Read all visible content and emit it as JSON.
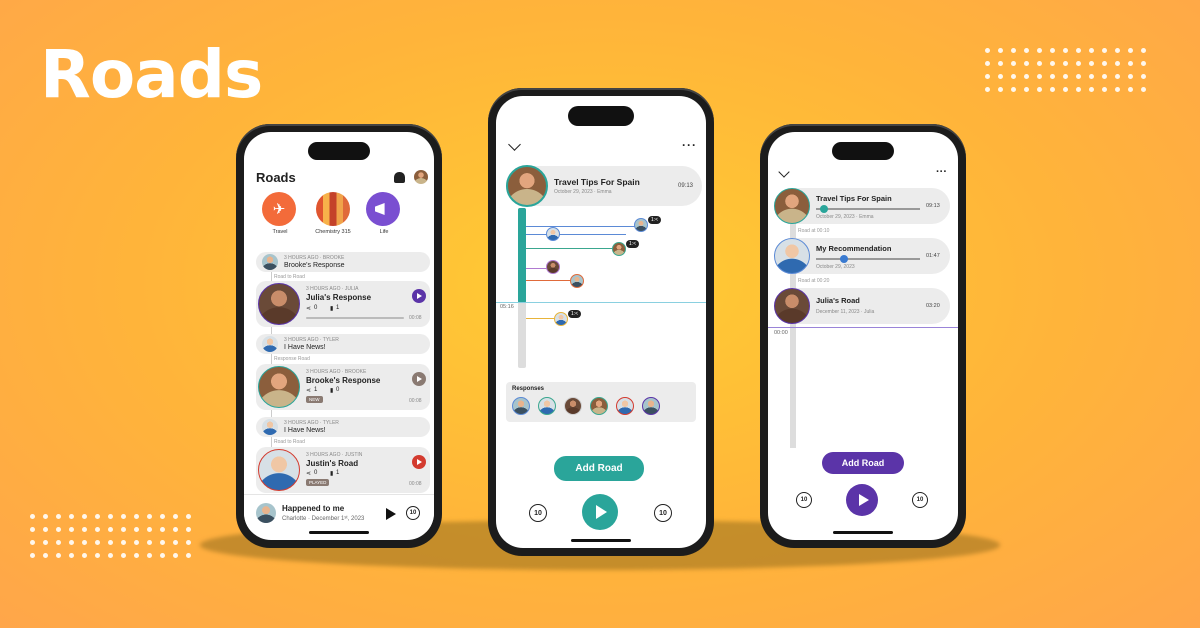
{
  "brand": {
    "name": "Roads"
  },
  "colors": {
    "teal": "#2aa59a",
    "purple": "#5b34a8",
    "accent_orange": "#ffb43a"
  },
  "phone_left": {
    "app_logo": "Roads",
    "categories": [
      {
        "label": "Travel",
        "icon": "airplane-icon",
        "color": "#f36b3a"
      },
      {
        "label": "Chemistry 315",
        "icon": "books-icon",
        "color": "#f0a34a"
      },
      {
        "label": "Life",
        "icon": "megaphone-icon",
        "color": "#7a4fd1"
      }
    ],
    "feed": [
      {
        "meta": "3 HOURS AGO · BROOKE",
        "title": "Brooke's Response",
        "compact": true
      },
      {
        "connector": "Road to Road"
      },
      {
        "meta": "3 HOURS AGO · JULIA",
        "title": "Julia's Response",
        "shares": "0",
        "plays": "1",
        "duration": "00:08",
        "play_color": "#5b34a8"
      },
      {
        "meta": "3 HOURS AGO · TYLER",
        "title": "I Have News!",
        "compact": true
      },
      {
        "connector": "Response Road"
      },
      {
        "meta": "3 HOURS AGO · BROOKE",
        "title": "Brooke's Response",
        "shares": "1",
        "plays": "0",
        "duration": "00:08",
        "badge": "NEW",
        "play_color": "#8a7a72"
      },
      {
        "meta": "3 HOURS AGO · TYLER",
        "title": "I Have News!",
        "compact": true
      },
      {
        "connector": "Road to Road"
      },
      {
        "meta": "3 HOURS AGO · JUSTIN",
        "title": "Justin's Road",
        "shares": "0",
        "plays": "1",
        "duration": "00:08",
        "badge": "PLAYED",
        "play_color": "#d33b2f"
      }
    ],
    "now_playing": {
      "title": "Happened to me",
      "subtitle": "Charlotte · December 1ˢᵗ, 2023",
      "skip": "10"
    }
  },
  "phone_center": {
    "header": {
      "title": "Travel Tips For Spain",
      "subtitle": "October 29, 2023 · Emma",
      "time": "09:13"
    },
    "branch_badges": [
      "1:<",
      "1:<",
      "1:<"
    ],
    "timestamp": "05:16",
    "responses_label": "Responses",
    "add_button": "Add Road",
    "skip_back": "10",
    "skip_forward": "10"
  },
  "phone_right": {
    "items": [
      {
        "title": "Travel Tips For Spain",
        "subtitle": "October 29, 2023 · Emma",
        "time": "09:13",
        "connector": "Road at 00:10"
      },
      {
        "title": "My Recommendation",
        "subtitle": "October 29, 2023",
        "time": "01:47",
        "connector": "Road at 00:20"
      },
      {
        "title": "Julia's Road",
        "subtitle": "December 11, 2023 · Julia",
        "time": "03:20",
        "connector": ""
      }
    ],
    "timestamp": "00:00",
    "add_button": "Add Road",
    "skip_back": "10",
    "skip_forward": "10"
  }
}
